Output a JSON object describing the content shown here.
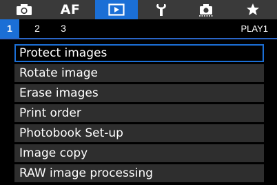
{
  "tabs": [
    {
      "name": "shooting",
      "icon": "camera-icon"
    },
    {
      "name": "af",
      "label": "AF"
    },
    {
      "name": "playback",
      "icon": "play-icon",
      "active": true
    },
    {
      "name": "setup",
      "icon": "wrench-icon"
    },
    {
      "name": "custom",
      "icon": "custom-functions-icon"
    },
    {
      "name": "mymenu",
      "icon": "star-icon"
    }
  ],
  "pages": [
    "1",
    "2",
    "3"
  ],
  "active_page": "1",
  "page_label": "PLAY1",
  "menu": {
    "items": [
      "Protect images",
      "Rotate image",
      "Erase images",
      "Print order",
      "Photobook Set-up",
      "Image copy",
      "RAW image processing"
    ],
    "selected_index": 0
  },
  "colors": {
    "accent": "#1b6fd6",
    "tabbar": "#3a3a3a",
    "item_bg": "#2e2e2e",
    "background": "#000000"
  }
}
